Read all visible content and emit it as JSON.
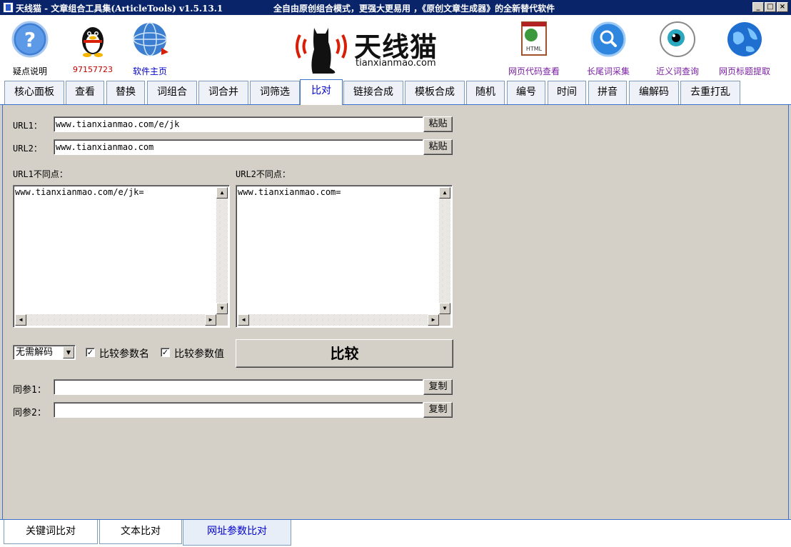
{
  "window": {
    "title": "天线猫 - 文章组合工具集(ArticleTools) v1.5.13.1",
    "slogan": "全自由原创组合模式，更强大更易用 ，《原创文章生成器》的全新替代软件",
    "min_btn": "_",
    "max_btn": "□",
    "close_btn": "×"
  },
  "toolbar": {
    "help": "疑点说明",
    "qq": "97157723",
    "homepage": "软件主页",
    "html_view": "网页代码查看",
    "longtail": "长尾词采集",
    "synonym": "近义词查询",
    "title_extract": "网页标题提取"
  },
  "logo": {
    "brand": "天线猫",
    "domain": "tianxianmao.com"
  },
  "tabs": [
    "核心面板",
    "查看",
    "替换",
    "词组合",
    "词合并",
    "词筛选",
    "比对",
    "链接合成",
    "模板合成",
    "随机",
    "编号",
    "时间",
    "拼音",
    "编解码",
    "去重打乱"
  ],
  "active_tab": "比对",
  "form": {
    "url1_label": "URL1：",
    "url1_value": "www.tianxianmao.com/e/jk",
    "url2_label": "URL2：",
    "url2_value": "www.tianxianmao.com",
    "paste_label": "粘贴",
    "diff1_label": "URL1不同点：",
    "diff1_text": "www.tianxianmao.com/e/jk=",
    "diff2_label": "URL2不同点：",
    "diff2_text": "www.tianxianmao.com=",
    "decode_select": "无需解码",
    "cmp_name_label": "比较参数名",
    "cmp_name_checked": "✓",
    "cmp_value_label": "比较参数值",
    "cmp_value_checked": "✓",
    "compare_btn": "比较",
    "same1_label": "同参1：",
    "same1_value": "",
    "same2_label": "同参2：",
    "same2_value": "",
    "copy_label": "复制"
  },
  "bottom_tabs": [
    "关键词比对",
    "文本比对",
    "网址参数比对"
  ],
  "active_bottom_tab": "网址参数比对"
}
